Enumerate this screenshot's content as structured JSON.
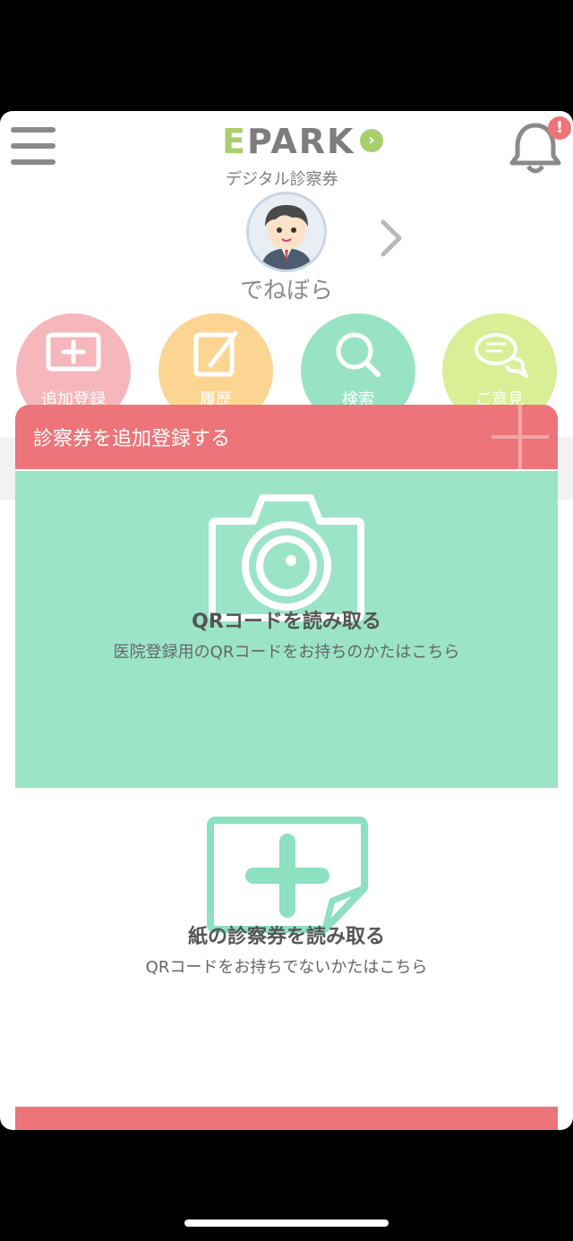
{
  "header": {
    "logo_letter_e": "E",
    "logo_word_rest": "PARK",
    "logo_subtitle": "デジタル診察券",
    "notification_badge": "!"
  },
  "profile": {
    "username": "でねぼら"
  },
  "actions": [
    {
      "label": "追加登録",
      "icon": "add-card-icon",
      "color": "#f5b7bb"
    },
    {
      "label": "履歴",
      "icon": "pencil-note-icon",
      "color": "#fcd593"
    },
    {
      "label": "検索",
      "icon": "search-icon",
      "color": "#99e3c5"
    },
    {
      "label": "ご意見",
      "icon": "speech-bubbles-icon",
      "color": "#d9ee95"
    }
  ],
  "sheet": {
    "title": "診察券を追加登録する",
    "options": [
      {
        "title": "QRコードを読み取る",
        "subtitle": "医院登録用のQRコードをお持ちのかたはこちら",
        "icon": "camera-icon"
      },
      {
        "title": "紙の診察券を読み取る",
        "subtitle": "QRコードをお持ちでないかたはこちら",
        "icon": "add-card-icon"
      }
    ]
  },
  "colors": {
    "accent_red": "#ed7579",
    "mint": "#9ce4c8",
    "brand_green": "#a7cf6b"
  }
}
